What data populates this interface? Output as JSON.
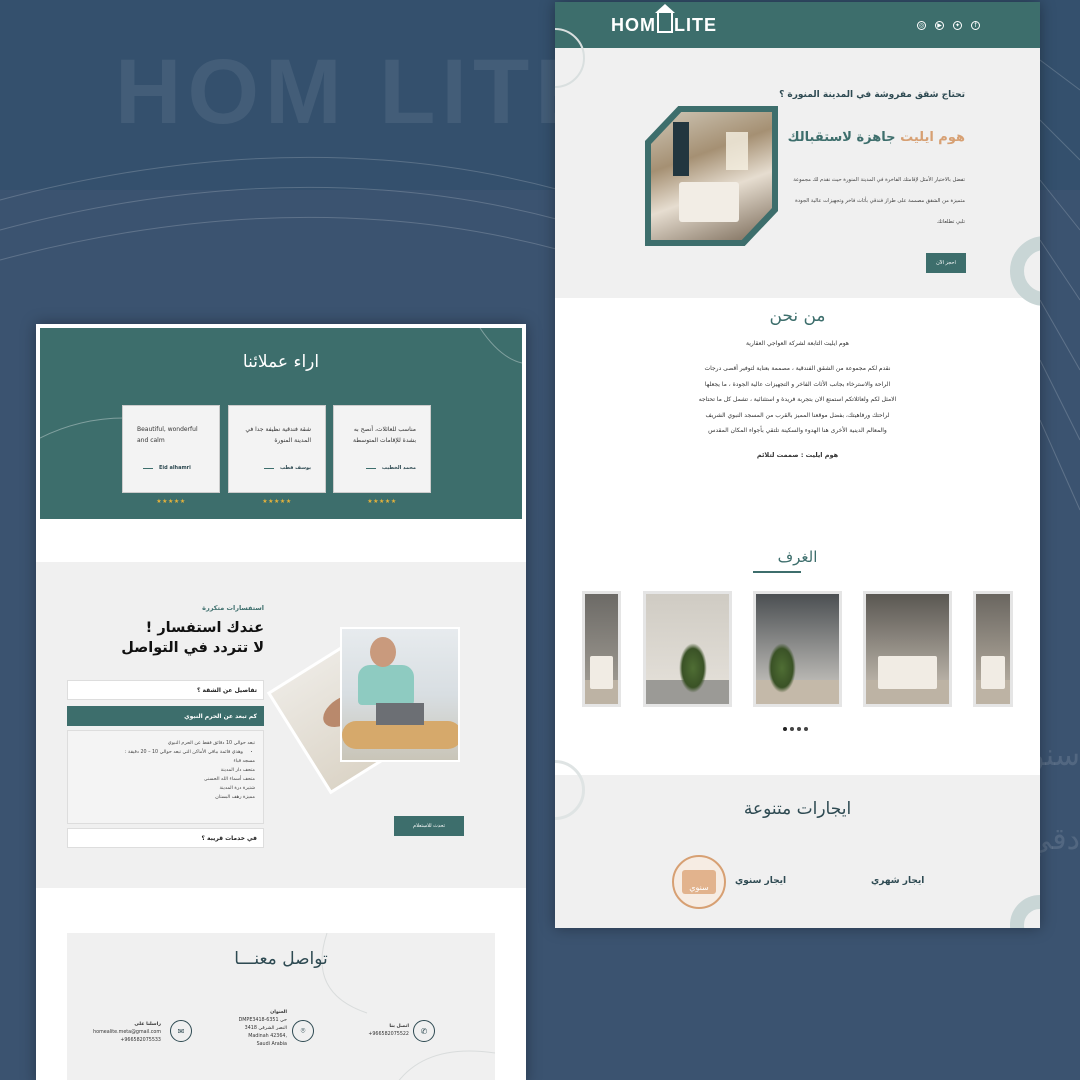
{
  "background": {
    "watermark_logo": "HOM LITE",
    "side_text_1": "سنور",
    "side_text_2": "دقي"
  },
  "colors": {
    "primary": "#3d6e6c",
    "accent": "#d7a073",
    "page_bg": "#3b5370",
    "light_section": "#f0f0f0"
  },
  "right_page": {
    "header": {
      "logo_left": "HOM",
      "logo_right": "LITE",
      "social_icons": [
        "instagram-icon",
        "youtube-icon",
        "twitter-icon",
        "facebook-icon"
      ]
    },
    "hero": {
      "question": "تحتاج شقق مفروشة في المدينة المنورة ؟",
      "title_accent": "هوم ايليت",
      "title_rest": "جاهزة لاستقبالك",
      "paragraph": "تفضل بالاختيار الأمثل لإقامتك الفاخرة في المدينة المنورة حيث نقدم لك مجموعة متميزة من الشقق مصممة على طراز فندقي بأثاث فاخر وتجهيزات عالية الجودة تلبي تطلعاتك",
      "button": "احجز الآن"
    },
    "about": {
      "title": "من نحن",
      "subtitle": "هوم ايليت التابعة لشركة العواجي العقارية",
      "paragraph": "نقدم لكم مجموعة من الشقق الفندقية ، مصممة بعناية لتوفير أقصى درجات الراحة والاسترخاء بجانب الأثاث الفاخر و التجهيزات عالية الجودة ، ما يجعلها الامثل لكم ولعائلاتكم استمتع الان بتجربة فريدة و استثنائية ، تشمل كل ما تحتاجه لراحتك ورفاهيتك، بفضل موقعنا المميز بالقرب من المسجد النبوي الشريف والمعالم الدينية الأخرى هنا الهدوء والسكينة تلتقي بأجواء المكان المقدس",
      "tagline": "هوم ايليت : صممت لتلائم"
    },
    "rooms": {
      "title": "الغرف",
      "carousel_dots": 4
    },
    "rentals": {
      "title": "ايجارات متنوعة",
      "monthly": "ايجار شهري",
      "yearly": "ايجار سنوي",
      "yearly_badge": "سنوي"
    }
  },
  "left_page": {
    "testimonials": {
      "title": "اراء عملائنا",
      "cards": [
        {
          "text": "مناسب للعائلات، أنصح به بشدة للإقامات المتوسطة",
          "name": "محمد الخطيب",
          "stars": "★★★★★"
        },
        {
          "text": "شقة فندقية نظيفة جدا في المدينة المنورة",
          "name": "يوسف قطب",
          "stars": "★★★★★"
        },
        {
          "text": "Beautiful, wonderful and calm",
          "name": "Eid alhamri",
          "stars": "★★★★★"
        }
      ]
    },
    "faq": {
      "small_title": "استفسارات متكررة",
      "big_title_line1": "عندك استفسار !",
      "big_title_line2": "لا تتردد في التواصل",
      "items": [
        {
          "question": "تفاصيل عن الشقة ؟"
        },
        {
          "question": "كم تبعد عن الحرم النبوي"
        },
        {
          "question": "في خدمات قريبة ؟"
        }
      ],
      "answer_intro": "تبعد حوالي 10 دقائق فقط عن الحرم النبوي",
      "answer_bullet": "وهذي قائمة بباقي الأماكن التي تبعد حوالي 10 – 20 دقيقة :",
      "answer_places": [
        "مسجد قباء",
        "متحف دار المدينة",
        "متحف أسماء الله الحسنى",
        "شتيرة درة المدينة",
        "مميزة رهف البستان"
      ],
      "button": "تحدث للاستعلام"
    },
    "contact": {
      "title": "تواصل معنـــا",
      "phone_label": "اتصل بنا",
      "phone_value": "+966582075522",
      "address_label": "العنوان",
      "address_value": "DMPE3418-6351 حي النصر الشرقي 3418 Madinah 42364, Saudi Arabia",
      "email_label": "راسلنا على",
      "email_value": "homealite.meta@gmail.com",
      "email_phone": "+966582075533"
    }
  }
}
